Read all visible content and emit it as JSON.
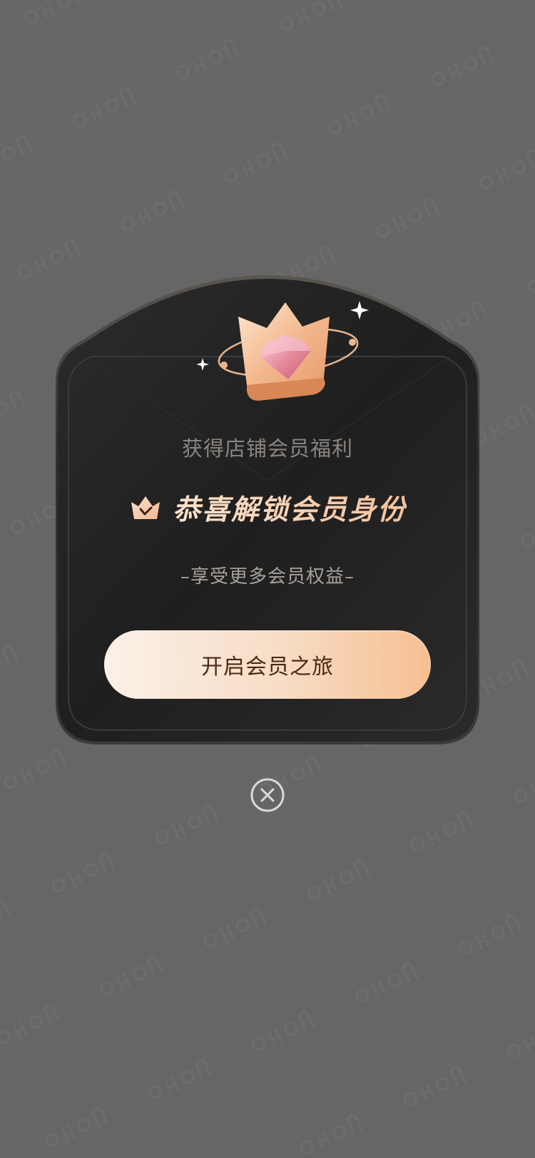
{
  "popup": {
    "subtitle": "获得店铺会员福利",
    "headline": "恭喜解锁会员身份",
    "tagline": "–享受更多会员权益–",
    "cta_label": "开启会员之旅"
  },
  "icons": {
    "hero": "crown-diamond-icon",
    "badge": "crown-check-icon",
    "close": "close-circle-icon"
  },
  "colors": {
    "backdrop": "#666666",
    "card": "#242424",
    "headline": "#f3c6a4",
    "cta_start": "#fbf1e8",
    "cta_end": "#f6bf91",
    "cta_text": "#4b2a12"
  }
}
